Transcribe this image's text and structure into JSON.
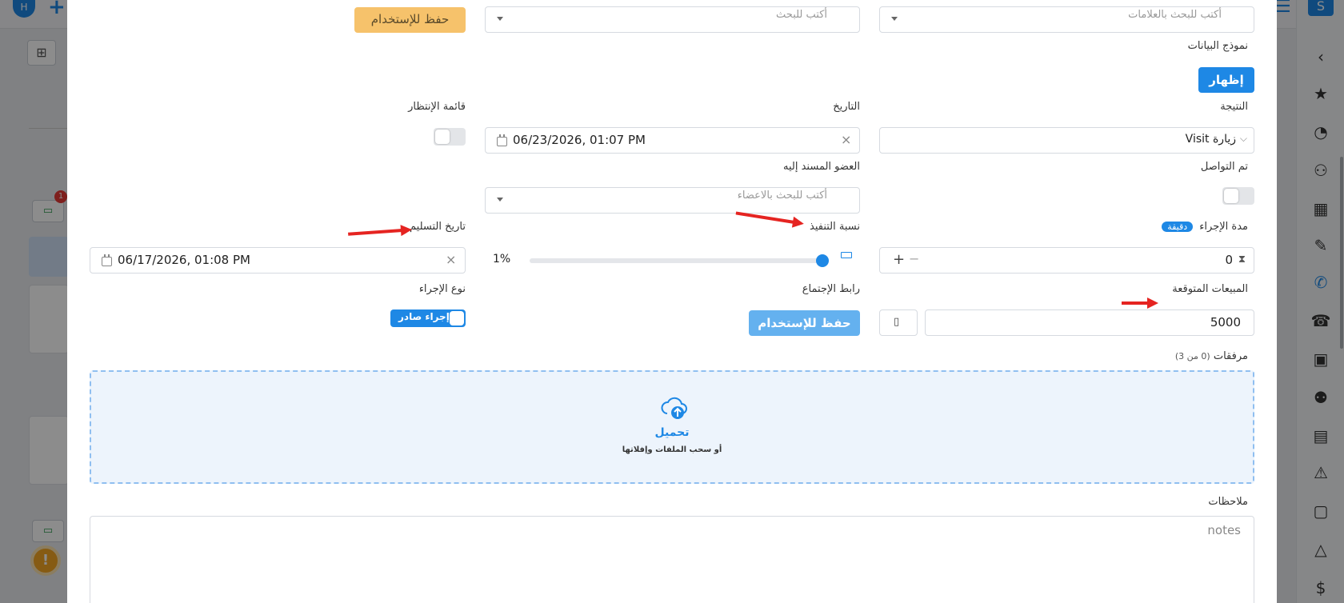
{
  "background": {
    "avatar_initial": "H",
    "badge_count": "1"
  },
  "form": {
    "tags_search_placeholder": "أكتب للبحث بالعلامات",
    "search_placeholder": "أكتب للبحث",
    "save_for_use_top": "حفظ للإستخدام",
    "data_model_label": "نموذج البيانات",
    "show_button": "إظهار",
    "result_label": "النتيجة",
    "result_value": "Visit زيارة",
    "date_label": "التاريخ",
    "date_value": "06/23/2026, 01:07 PM",
    "waitlist_label": "قائمة الإنتظار",
    "contacted_label": "تم التواصل",
    "assigned_member_label": "العضو المسند إليه",
    "members_search_placeholder": "أكتب للبحث بالاعضاء",
    "duration_label": "مدة الإجراء",
    "duration_unit": "دقيقة",
    "duration_value": "0",
    "progress_label": "نسبة التنفيذ",
    "progress_value": "1%",
    "delivery_date_label": "تاريخ التسليم",
    "delivery_date_value": "06/17/2026, 01:08 PM",
    "expected_sales_label": "المبيعات المتوقعة",
    "expected_sales_value": "5000",
    "meeting_link_label": "رابط الإجتماع",
    "save_for_use_meeting": "حفظ للإستخدام",
    "action_type_label": "نوع الإجراء",
    "action_type_value": "إجراء صادر",
    "attachments_label": "مرفقات",
    "attachments_count": "(0 من 3)",
    "upload_title": "تحميل",
    "upload_hint": "أو سحب الملفات وإفلاتها",
    "notes_label": "ملاحظات",
    "notes_placeholder": "notes"
  },
  "colors": {
    "primary": "#1e88e5",
    "save_orange": "#f6c26b",
    "save_blue_light": "#64b1ef",
    "upload_bg": "#edf4fc",
    "annotation_red": "#e52421"
  },
  "progress": {
    "percent": 1
  }
}
